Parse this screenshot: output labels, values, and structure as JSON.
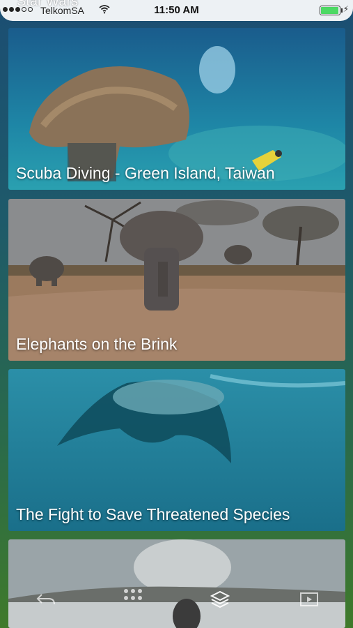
{
  "status_bar": {
    "ghost_title": "Star Wars",
    "carrier": "TelkomSA",
    "time": "11:50 AM",
    "battery_level": 0.95
  },
  "cards": [
    {
      "title": "Scuba Diving - Green Island, Taiwan"
    },
    {
      "title": "Elephants on the Brink"
    },
    {
      "title": "The Fight to Save Threatened Species"
    },
    {
      "title": ""
    }
  ],
  "toolbar": {
    "icons": [
      "back-arrow-icon",
      "more-dots-icon",
      "layers-icon",
      "play-icon"
    ]
  }
}
